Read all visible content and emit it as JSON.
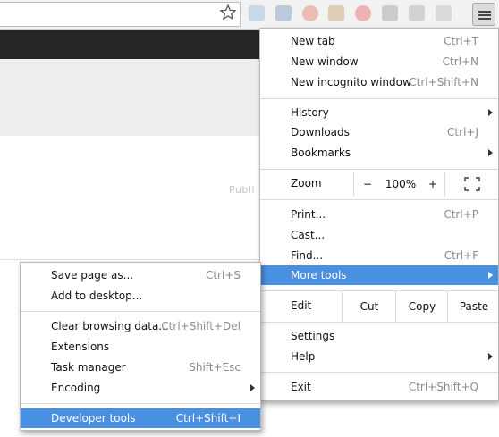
{
  "main_menu": {
    "items": [
      {
        "label": "New tab",
        "shortcut": "Ctrl+T"
      },
      {
        "label": "New window",
        "shortcut": "Ctrl+N"
      },
      {
        "label": "New incognito window",
        "shortcut": "Ctrl+Shift+N"
      },
      {
        "label": "History",
        "shortcut": ""
      },
      {
        "label": "Downloads",
        "shortcut": "Ctrl+J"
      },
      {
        "label": "Bookmarks",
        "shortcut": ""
      },
      {
        "label": "Print...",
        "shortcut": "Ctrl+P"
      },
      {
        "label": "Cast...",
        "shortcut": ""
      },
      {
        "label": "Find...",
        "shortcut": "Ctrl+F"
      },
      {
        "label": "More tools",
        "shortcut": ""
      },
      {
        "label": "Settings",
        "shortcut": ""
      },
      {
        "label": "Help",
        "shortcut": ""
      },
      {
        "label": "Exit",
        "shortcut": "Ctrl+Shift+Q"
      }
    ],
    "zoom": {
      "label": "Zoom",
      "minus": "−",
      "value": "100%",
      "plus": "+"
    },
    "edit": {
      "label": "Edit",
      "cut": "Cut",
      "copy": "Copy",
      "paste": "Paste"
    }
  },
  "sub_menu": {
    "items": [
      {
        "label": "Save page as...",
        "shortcut": "Ctrl+S"
      },
      {
        "label": "Add to desktop...",
        "shortcut": ""
      },
      {
        "label": "Clear browsing data...",
        "shortcut": "Ctrl+Shift+Del"
      },
      {
        "label": "Extensions",
        "shortcut": ""
      },
      {
        "label": "Task manager",
        "shortcut": "Shift+Esc"
      },
      {
        "label": "Encoding",
        "shortcut": ""
      },
      {
        "label": "Developer tools",
        "shortcut": "Ctrl+Shift+I"
      }
    ]
  },
  "background": {
    "ghost_text": "Publi"
  },
  "colors": {
    "highlight": "#4a90e2",
    "dark_bar": "#262626"
  }
}
